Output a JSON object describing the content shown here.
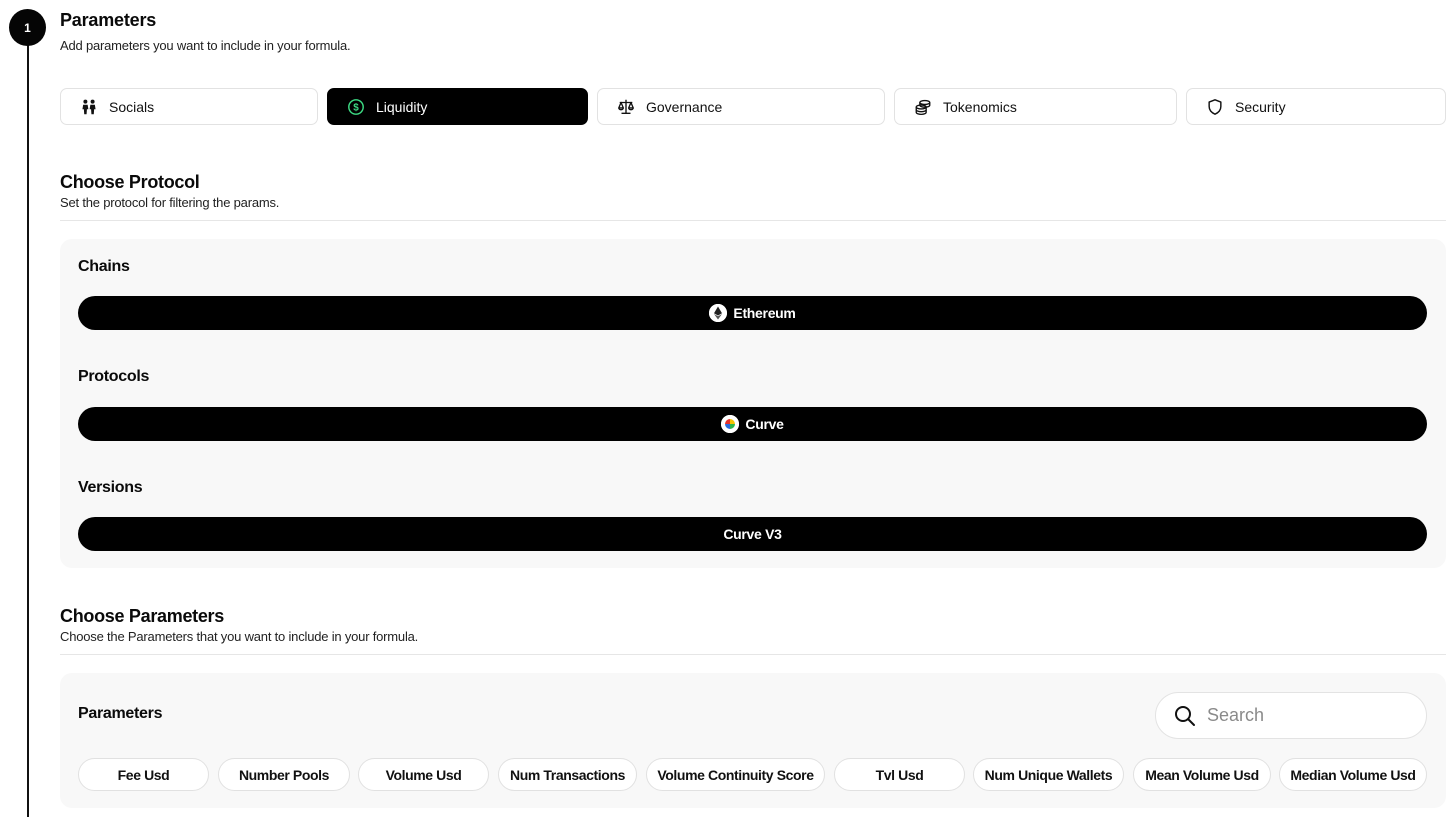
{
  "step": {
    "number": "1"
  },
  "header": {
    "title": "Parameters",
    "subtitle": "Add parameters you want to include in your formula."
  },
  "tabs": [
    {
      "label": "Socials",
      "icon": "people-icon",
      "active": false
    },
    {
      "label": "Liquidity",
      "icon": "dollar-circle-icon",
      "active": true
    },
    {
      "label": "Governance",
      "icon": "scale-icon",
      "active": false
    },
    {
      "label": "Tokenomics",
      "icon": "coins-icon",
      "active": false
    },
    {
      "label": "Security",
      "icon": "shield-icon",
      "active": false
    }
  ],
  "protocol": {
    "title": "Choose Protocol",
    "subtitle": "Set the protocol for filtering the params.",
    "chains_label": "Chains",
    "chain": {
      "label": "Ethereum",
      "icon": "ethereum-icon"
    },
    "protocols_label": "Protocols",
    "protocol": {
      "label": "Curve",
      "icon": "curve-icon"
    },
    "versions_label": "Versions",
    "version": {
      "label": "Curve V3"
    }
  },
  "parameters": {
    "title": "Choose Parameters",
    "subtitle": "Choose the Parameters that you want to include in your formula.",
    "panel_label": "Parameters",
    "search_placeholder": "Search",
    "chips": [
      "Fee Usd",
      "Number Pools",
      "Volume Usd",
      "Num Transactions",
      "Volume Continuity Score",
      "Tvl Usd",
      "Num Unique Wallets",
      "Mean Volume Usd",
      "Median Volume Usd"
    ]
  },
  "colors": {
    "active_bg": "#000000",
    "accent_green": "#3ddc84",
    "panel_bg": "#f8f8f8"
  }
}
